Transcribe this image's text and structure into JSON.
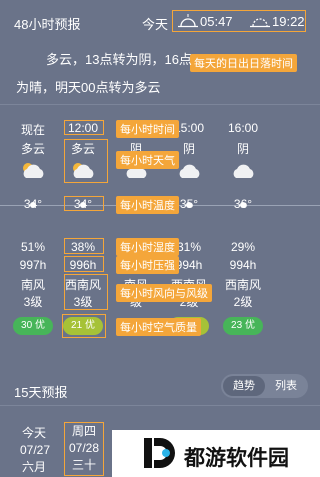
{
  "header": {
    "title": "48小时预报",
    "today": "今天",
    "sunrise": "05:47",
    "sunset": "19:22"
  },
  "summary": {
    "line1": "多云，13点转为阴，16点",
    "line2": "为晴，明天00点转为多云"
  },
  "hours": [
    {
      "time": "现在",
      "weather": "多云",
      "temp": "34°",
      "humidity": "51%",
      "pressure": "997h",
      "wind_dir": "南风",
      "wind_level": "3级",
      "aqi": "30 优"
    },
    {
      "time": "12:00",
      "weather": "多云",
      "temp": "34°",
      "humidity": "38%",
      "pressure": "996h",
      "wind_dir": "西南风",
      "wind_level": "3级",
      "aqi": "21 优"
    },
    {
      "time": "4:00",
      "weather": "阴",
      "temp": "36°",
      "humidity": "3%",
      "pressure": "95h",
      "wind_dir": "南风",
      "wind_level": "级",
      "aqi": ""
    },
    {
      "time": "15:00",
      "weather": "阴",
      "temp": "35°",
      "humidity": "31%",
      "pressure": "994h",
      "wind_dir": "西南风",
      "wind_level": "2级",
      "aqi": "21 优"
    },
    {
      "time": "16:00",
      "weather": "阴",
      "temp": "36°",
      "humidity": "29%",
      "pressure": "994h",
      "wind_dir": "西南风",
      "wind_level": "2级",
      "aqi": "23 优"
    }
  ],
  "annotations": {
    "sun": "每天的日出日落时间",
    "time": "每小时时间",
    "weather": "每小时天气",
    "temp": "每小时温度",
    "humidity": "每小时湿度",
    "pressure": "每小时压强",
    "wind": "每小时风向与风级",
    "aqi": "每小时空气质量"
  },
  "forecast15": {
    "title": "15天预报",
    "tab_trend": "趋势",
    "tab_list": "列表",
    "rows": [
      {
        "label": "今天",
        "value": "周四"
      },
      {
        "label": "07/27",
        "value": "07/28"
      },
      {
        "label": "六月",
        "value": "三十"
      }
    ]
  },
  "watermark": "都游软件园"
}
